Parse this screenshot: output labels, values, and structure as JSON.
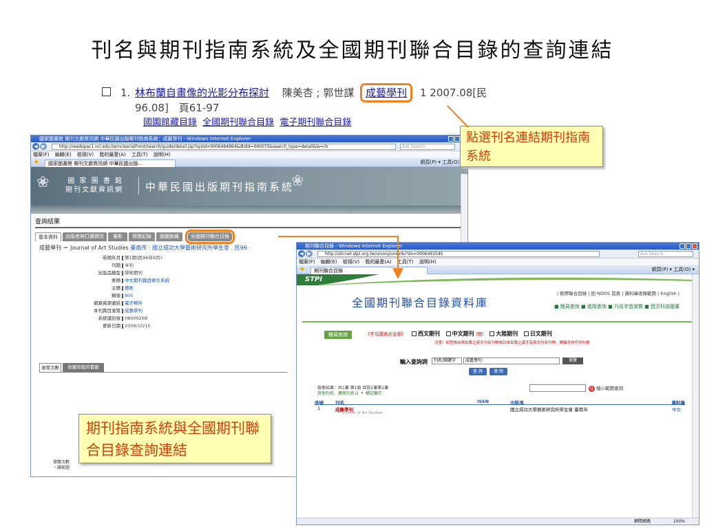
{
  "slide": {
    "title": "刊名與期刊指南系統及全國期刊聯合目錄的查詢連結"
  },
  "result": {
    "number": "1.",
    "article_title": "林布蘭自畫像的光影分布探討",
    "authors": "陳美杏 ; 郭世謀",
    "journal": "成藝學刊",
    "tail": "1 2007.08[民",
    "line2": "96.08]　頁61-97",
    "links": [
      "國圖館藏目錄",
      "全國期刊聯合目錄",
      "電子期刊聯合目錄"
    ]
  },
  "callouts": {
    "top": "點選刊名連結期刊指南系統",
    "bottom": "期刊指南系統與全國期刊聯合目錄查詢連結"
  },
  "win1": {
    "window_title": "國家圖書館 期刊文獻資訊網 中華民國出版期刊指南系統：成藝學刊 - Windows Internet Explorer",
    "url": "http://readopac1.ncl.edu.tw/nclserialFront/search/guide/detail.jsp?sysId=0006494864&dtdId=000075&search_type=detail&la=ch",
    "search_placeholder": "Ask Search",
    "menu": [
      "檔案(F)",
      "編輯(E)",
      "檢視(V)",
      "我的最愛(A)",
      "工具(T)",
      "說明(H)"
    ],
    "tab_label": "國家圖書館 期刊文獻資訊網 中華民國出版...",
    "toolbar_right": "網頁(P) ▾  工具(O) ▾",
    "logo_line1": "國 家 圖 書 館",
    "logo_line2": "期刊文獻資訊網",
    "system_name": "中華民國出版期刊指南系統",
    "section_title": "查詢結果",
    "tabs": [
      "基本資料",
      "出版者與訂購資訊",
      "書影",
      "得獎紀錄",
      "國圖館藏",
      "全國期刊聯合目錄"
    ],
    "journal_line_name": "成藝學刊 ＝ Journal of Art Studies",
    "journal_line_pub": "臺南市 : 國立成功大學藝術研究所學生會 . 民96-",
    "rows": [
      {
        "label": "卷期年月",
        "value": "第1期(民96年8月)-"
      },
      {
        "label": "刊期",
        "value": "半刊"
      },
      {
        "label": "出版品類型",
        "value": "學術期刊"
      },
      {
        "label": "索摘",
        "value": "中文期刊篇目索引系統"
      },
      {
        "label": "主題",
        "value": "藝術"
      },
      {
        "label": "類號",
        "value": "905"
      },
      {
        "label": "網路資源連結",
        "value": "電子郵件"
      },
      {
        "label": "本刊篇目瀏覽",
        "value": "成藝學刊"
      },
      {
        "label": "系統識別號",
        "value": "08000268"
      },
      {
        "label": "更新日期",
        "value": "2009/10/15"
      }
    ],
    "low_tabs": [
      "瀏覽次數",
      "收藏到我的書籤"
    ],
    "views_label": "瀏覽次數",
    "views_sub": "・國家圖"
  },
  "win2": {
    "window_title": "期刊聯合目錄 - Windows Internet Explorer",
    "url": "http://sticnet.stpi.org.tw/unionj/unionb/?dn=0006491545",
    "search_placeholder": "Ask Search",
    "menu": [
      "檔案(F)",
      "編輯(E)",
      "檢視(V)",
      "我的最愛(A)",
      "工具(T)",
      "說明(H)"
    ],
    "tab_label": "期刊聯合目錄",
    "toolbar_right": "網頁(P) ▾  工具(O) ▾",
    "brand": "STPI",
    "db_name": "全國期刊聯合目錄資料庫",
    "top_links": "| 館際聯合目錄 | 回 NDDS 首頁 | 資料庫收錄範圍 | English |",
    "sub_links": "■ 簡易查詢 ■ 進階查詢 ■ 刊名字首瀏覽 ■ 西文科技圖書",
    "easy_search": "簡易查詢",
    "opt_all": "《不勾選表示全部》",
    "opts": [
      "西文期刊",
      "中文期刊",
      "大陸期刊",
      "日文期刊"
    ],
    "opt_note": "(簡)",
    "notice": "注意！如查詢台灣出版之英文刊名刊物或日本出版之漢字及英文刊名刊物，建議不作任何勾選",
    "input_label": "輸入查詢詞",
    "select_value": "刊名/關鍵字",
    "query_value": "成藝學刊",
    "browse": "瀏覽",
    "btn_query": "查 詢",
    "btn_clear": "清 除",
    "count_line": "檢索結果：共1筆 第1頁 目前1筆第1筆",
    "alt_line": "其他刊名、擴寫刊名以 ＊ 標記顯示",
    "narrow": "縮小範圍查詢",
    "headers": {
      "no": "序號",
      "title": "刊名",
      "issn": "ISSN",
      "publisher": "出版項",
      "lang": "資料庫"
    },
    "row": {
      "no": "1",
      "title": "成藝學刊",
      "alt": "* Journal of Art Studies",
      "publisher": "國立成功大學藝術研究所學生會 臺南市",
      "lang": "中文"
    },
    "status_net": "網際網路",
    "status_zoom": "100%"
  },
  "colors": {
    "highlight": "#f0811f",
    "callout_bg": "#ffffb3",
    "callout_text": "#d43e08",
    "link": "#1a1aa6",
    "stpi_green": "#2f7f3a"
  }
}
